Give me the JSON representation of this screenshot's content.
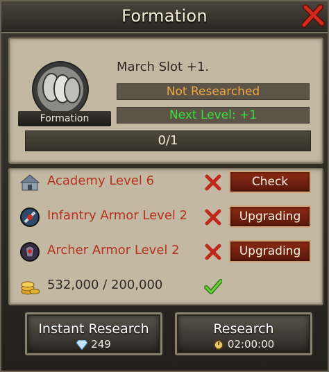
{
  "window": {
    "title": "Formation"
  },
  "tech": {
    "name_label": "Formation",
    "description": "March Slot +1.",
    "status": "Not Researched",
    "next_level": "Next Level: +1",
    "progress_text": "0/1",
    "progress_fraction": 0
  },
  "requirements": [
    {
      "label": "Academy Level 6",
      "icon": "academy-building-icon",
      "met": false,
      "button": "Check"
    },
    {
      "label": "Infantry Armor Level 2",
      "icon": "infantry-armor-icon",
      "met": false,
      "button": "Upgrading"
    },
    {
      "label": "Archer Armor Level 2",
      "icon": "archer-armor-icon",
      "met": false,
      "button": "Upgrading"
    },
    {
      "label": "532,000 / 200,000",
      "icon": "gold-coins-icon",
      "met": true
    }
  ],
  "actions": {
    "instant": {
      "label": "Instant Research",
      "cost": "249",
      "icon": "gem-icon"
    },
    "research": {
      "label": "Research",
      "time": "02:00:00",
      "icon": "stopwatch-icon"
    }
  },
  "colors": {
    "unmet_text": "#b5321f",
    "status_orange": "#f2a640",
    "next_level_green": "#3ae23a",
    "button_red": "#8a2a14"
  }
}
